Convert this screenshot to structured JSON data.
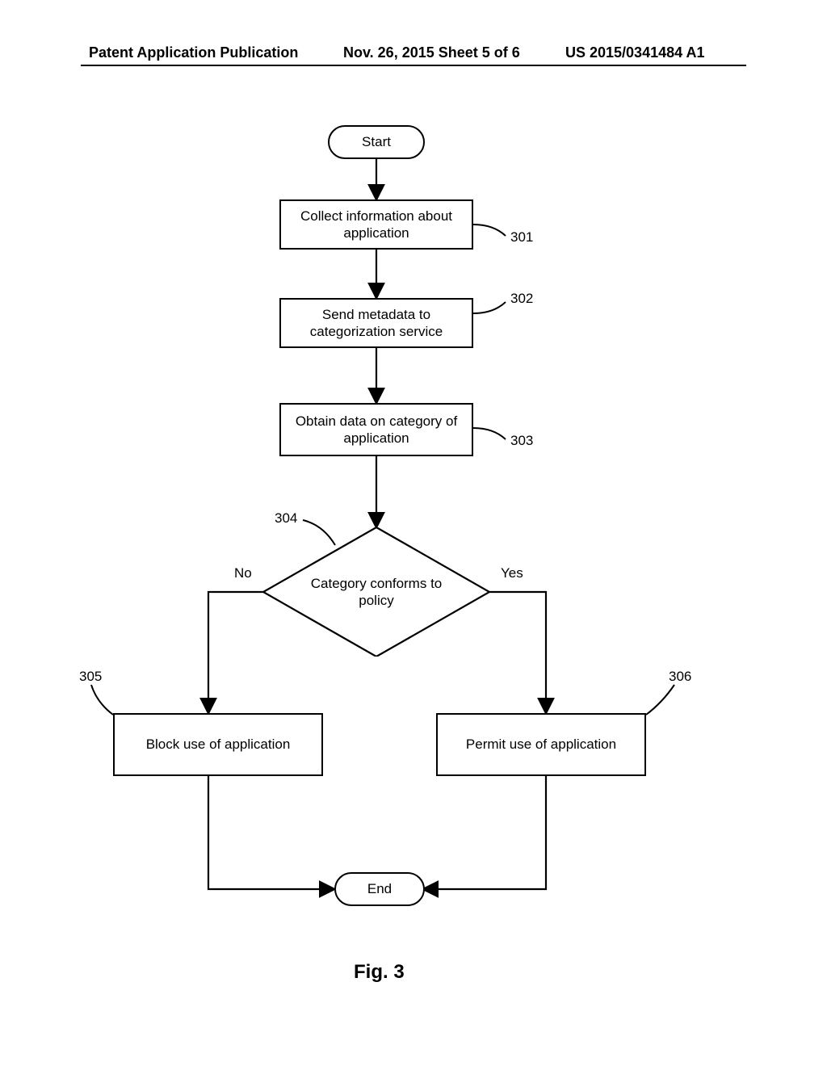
{
  "header": {
    "left": "Patent Application Publication",
    "center": "Nov. 26, 2015  Sheet 5 of 6",
    "right": "US 2015/0341484 A1"
  },
  "fig_caption": "Fig. 3",
  "nodes": {
    "start": "Start",
    "step301": "Collect information about application",
    "step302": "Send metadata to categorization service",
    "step303": "Obtain data on category of application",
    "decision304": "Category conforms to policy",
    "step305": "Block use of application",
    "step306": "Permit use of application",
    "end": "End"
  },
  "labels": {
    "ref301": "301",
    "ref302": "302",
    "ref303": "303",
    "ref304": "304",
    "ref305": "305",
    "ref306": "306",
    "no": "No",
    "yes": "Yes"
  }
}
